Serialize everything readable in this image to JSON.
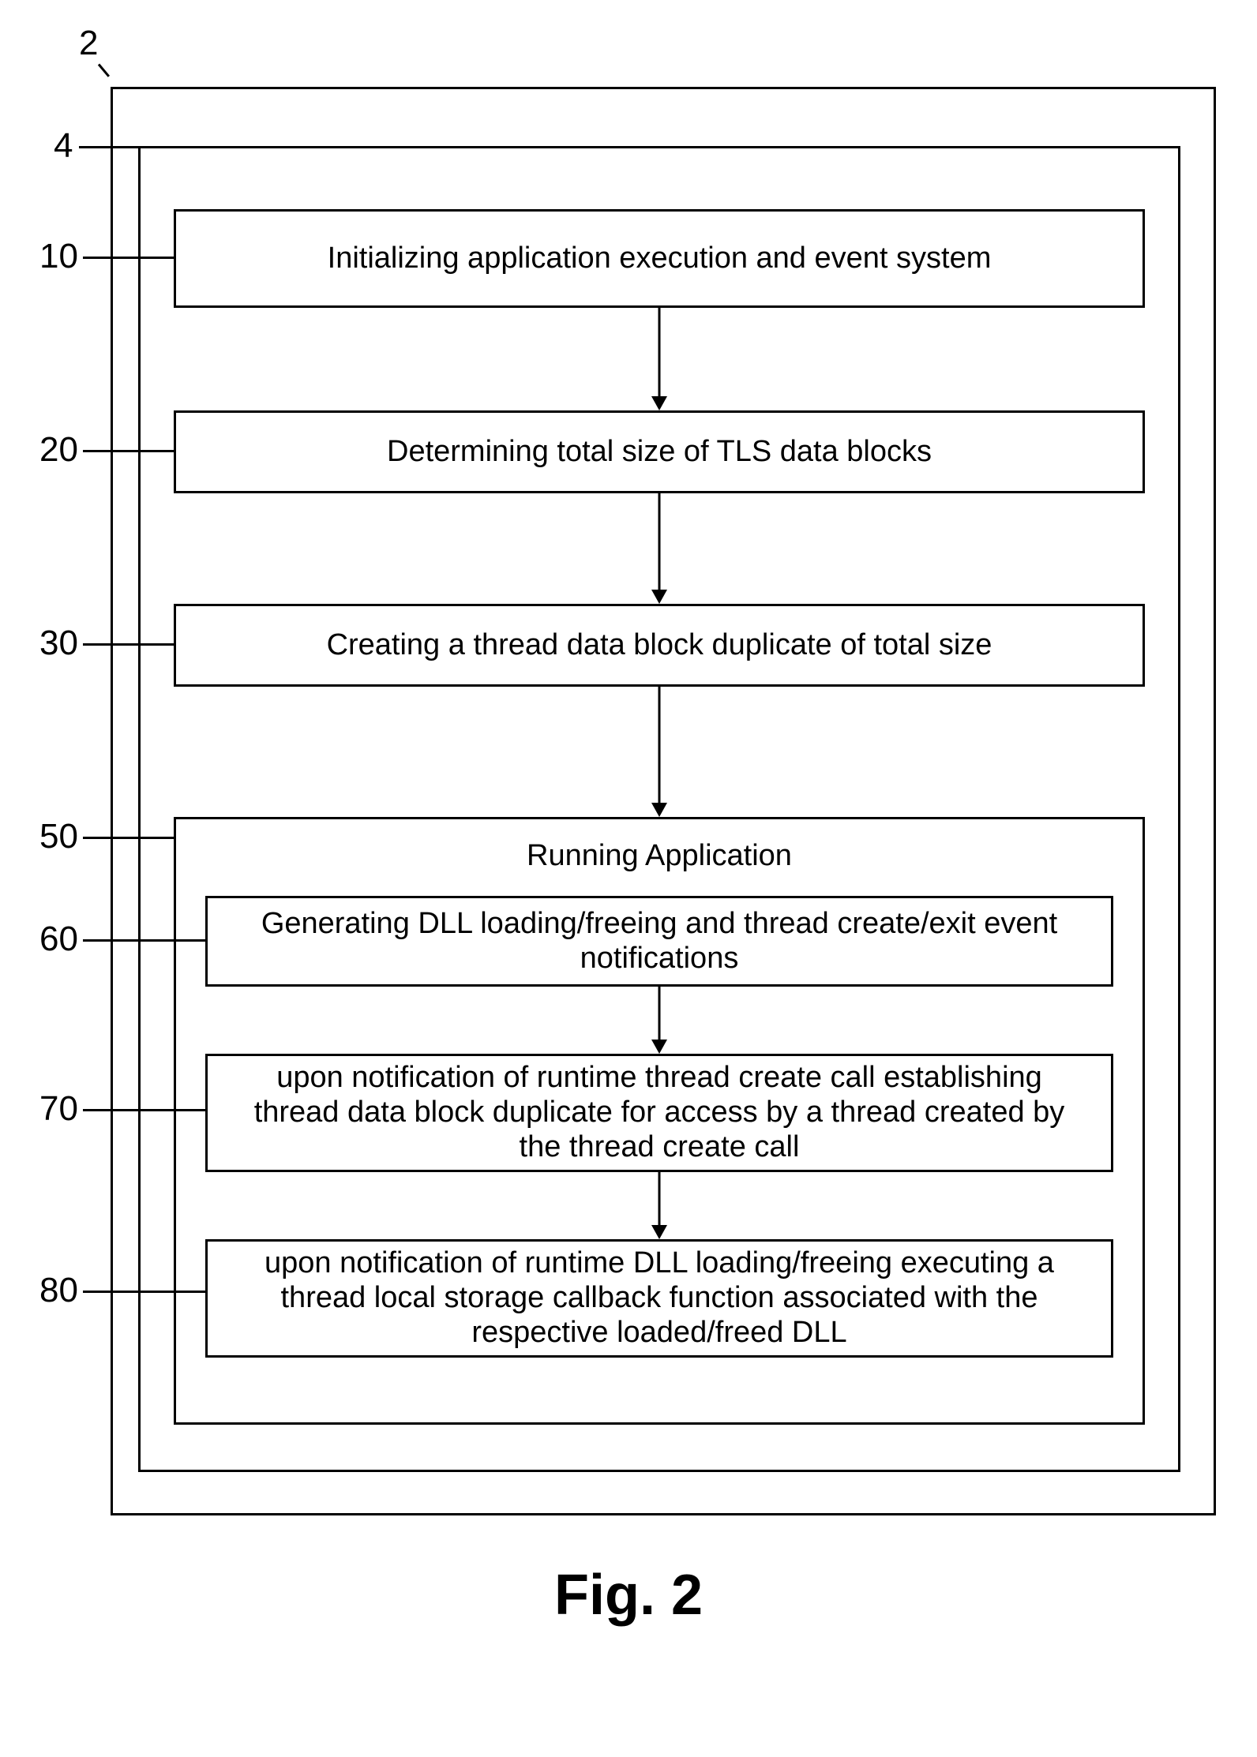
{
  "labels": {
    "l2": "2",
    "l4": "4",
    "l10": "10",
    "l20": "20",
    "l30": "30",
    "l50": "50",
    "l60": "60",
    "l70": "70",
    "l80": "80"
  },
  "steps": {
    "step10": "Initializing application execution and event system",
    "step20": "Determining total size of TLS data blocks",
    "step30": "Creating a thread data block duplicate of total size",
    "step50_title": "Running Application",
    "step60": "Generating DLL loading/freeing and thread create/exit event notifications",
    "step70": "upon notification of runtime thread create call establishing thread data block duplicate for access by a thread created by the thread create call",
    "step80": "upon notification of runtime DLL loading/freeing executing a thread local storage callback function associated with the respective loaded/freed DLL"
  },
  "caption": "Fig. 2"
}
